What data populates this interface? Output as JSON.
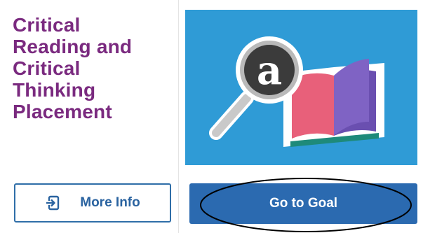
{
  "card": {
    "title_lines": [
      "Critical",
      "Reading and",
      "Critical",
      "Thinking",
      "Placement"
    ]
  },
  "cover": {
    "badge_letter": "a"
  },
  "buttons": {
    "more_info_label": "More Info",
    "go_to_goal_label": "Go to Goal"
  },
  "icons": {
    "more_info": "enter-arrow-icon",
    "cover": "magnifying-glass-book-icon"
  },
  "colors": {
    "title": "#7a2a7f",
    "cover_bg": "#2f9bd6",
    "primary_button": "#2b6ab0",
    "outline_button": "#2f6ea8"
  }
}
